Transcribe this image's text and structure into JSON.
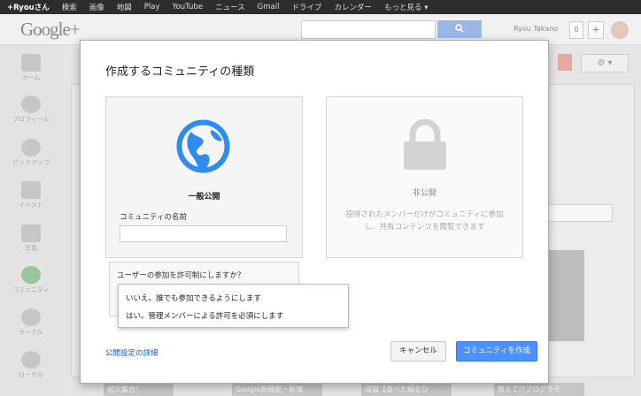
{
  "topbar": {
    "items": [
      "+Ryouさん",
      "検索",
      "画像",
      "地図",
      "Play",
      "YouTube",
      "ニュース",
      "Gmail",
      "ドライブ",
      "カレンダー",
      "もっと見る ▾"
    ]
  },
  "header": {
    "logo": "Google+",
    "username": "Ryou Takano",
    "notification_count": "0",
    "add_label": "+"
  },
  "sidebar": {
    "items": [
      {
        "label": "ホーム",
        "icon": "home-icon"
      },
      {
        "label": "プロフィール",
        "icon": "profile-icon"
      },
      {
        "label": "ピックアップ",
        "icon": "explore-icon"
      },
      {
        "label": "イベント",
        "icon": "calendar-icon"
      },
      {
        "label": "写真",
        "icon": "camera-icon"
      },
      {
        "label": "コミュニティ",
        "icon": "community-icon"
      },
      {
        "label": "サークル",
        "icon": "circles-icon"
      },
      {
        "label": "ローカル",
        "icon": "pin-icon"
      }
    ]
  },
  "background": {
    "gear_label": "⚙ ▾",
    "tiles": [
      "初大集合！",
      "Google新機能・新情",
      "海猫【食べた麺をひ",
      "教えて!?プログラミ"
    ]
  },
  "dialog": {
    "title": "作成するコミュニティの種類",
    "public": {
      "label": "一般公開",
      "name_label": "コミュニティの名前",
      "name_value": ""
    },
    "private": {
      "label": "非公開",
      "description": "招待されたメンバーだけがコミュニティに参加し、共有コンテンツを閲覧できます"
    },
    "question": "ユーザーの参加を許可制にしますか？",
    "options": [
      "いいえ。誰でも参加できるようにします",
      "はい。管理メンバーによる許可を必須にします"
    ],
    "details_link": "公開設定の詳細",
    "cancel_label": "キャンセル",
    "create_label": "コミュニティを作成"
  },
  "colors": {
    "primary_button": "#4d90fe",
    "globe": "#2e8cf0",
    "link": "#1a5cbf"
  }
}
